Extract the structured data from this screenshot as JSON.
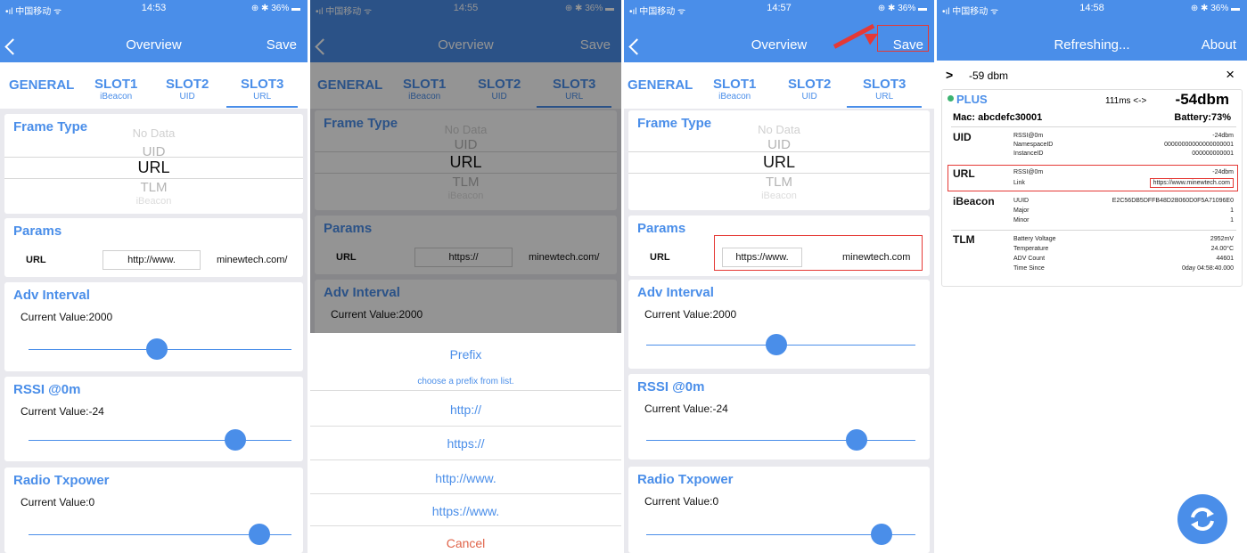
{
  "colors": {
    "accent": "#4a8ee9",
    "highlight": "#e53935",
    "cancel": "#e0644a",
    "online": "#3cb371"
  },
  "status": {
    "carrier": "•ıl 中国移动 ᯤ",
    "battery": "⊕ ✱ 36% ▬"
  },
  "screen1": {
    "time": "14:53",
    "title": "Overview",
    "save": "Save",
    "tabs": [
      {
        "label": "GENERAL",
        "sub": ""
      },
      {
        "label": "SLOT1",
        "sub": "iBeacon"
      },
      {
        "label": "SLOT2",
        "sub": "UID"
      },
      {
        "label": "SLOT3",
        "sub": "URL"
      }
    ],
    "frame_type": {
      "title": "Frame Type",
      "items": [
        "No Data",
        "UID",
        "URL",
        "TLM",
        "iBeacon"
      ],
      "selected": "URL"
    },
    "params": {
      "title": "Params",
      "label": "URL",
      "prefix": "http://www.",
      "suffix": "minewtech.com/"
    },
    "adv": {
      "title": "Adv Interval",
      "value": "Current Value:2000",
      "level": 0.5
    },
    "rssi": {
      "title": "RSSI @0m",
      "value": "Current Value:-24",
      "level": 0.78
    },
    "tx": {
      "title": "Radio Txpower",
      "value": "Current Value:0",
      "level": 0.9
    }
  },
  "screen2": {
    "time": "14:55",
    "title": "Overview",
    "save": "Save",
    "frame_type": {
      "title": "Frame Type",
      "items": [
        "No Data",
        "UID",
        "URL",
        "TLM",
        "iBeacon"
      ]
    },
    "params": {
      "title": "Params",
      "label": "URL",
      "prefix": "https://",
      "suffix": "minewtech.com/"
    },
    "adv": {
      "title": "Adv Interval",
      "value": "Current Value:2000"
    },
    "sheet": {
      "title": "Prefix",
      "subtitle": "choose a prefix from list.",
      "options": [
        "http://",
        "https://",
        "http://www.",
        "https://www."
      ],
      "cancel": "Cancel"
    }
  },
  "screen3": {
    "time": "14:57",
    "title": "Overview",
    "save": "Save",
    "frame_type": {
      "title": "Frame Type",
      "items": [
        "No Data",
        "UID",
        "URL",
        "TLM",
        "iBeacon"
      ]
    },
    "params": {
      "title": "Params",
      "label": "URL",
      "prefix": "https://www.",
      "suffix": "minewtech.com"
    },
    "adv": {
      "title": "Adv Interval",
      "value": "Current Value:2000",
      "level": 0.5
    },
    "rssi": {
      "title": "RSSI @0m",
      "value": "Current Value:-24",
      "level": 0.78
    },
    "tx": {
      "title": "Radio Txpower",
      "value": "Current Value:0",
      "level": 0.9
    }
  },
  "screen4": {
    "time": "14:58",
    "title": "Refreshing...",
    "about": "About",
    "filter": {
      "chevron": ">",
      "value": "-59 dbm",
      "close": "×"
    },
    "device": {
      "name": "PLUS",
      "interval": "111ms <->",
      "rssi": "-54dbm",
      "mac": "Mac: abcdefc30001",
      "battery": "Battery:73%",
      "uid": {
        "label": "UID",
        "rows": [
          [
            "RSSI@0m",
            "-24dbm"
          ],
          [
            "NamespaceID",
            "00000000000000000001"
          ],
          [
            "InstanceID",
            "000000000001"
          ]
        ]
      },
      "url": {
        "label": "URL",
        "rows": [
          [
            "RSSI@0m",
            "-24dbm"
          ],
          [
            "Link",
            "https://www.minewtech.com"
          ]
        ]
      },
      "ibeacon": {
        "label": "iBeacon",
        "rows": [
          [
            "UUID",
            "E2C56DB5DFFB48D2B060D0F5A71096E0"
          ],
          [
            "Major",
            "1"
          ],
          [
            "Minor",
            "1"
          ]
        ]
      },
      "tlm": {
        "label": "TLM",
        "rows": [
          [
            "Battery Voltage",
            "2952mV"
          ],
          [
            "Temperature",
            "24.00°C"
          ],
          [
            "ADV Count",
            "44601"
          ],
          [
            "Time Since",
            "0day 04:58:40.000"
          ]
        ]
      }
    }
  }
}
